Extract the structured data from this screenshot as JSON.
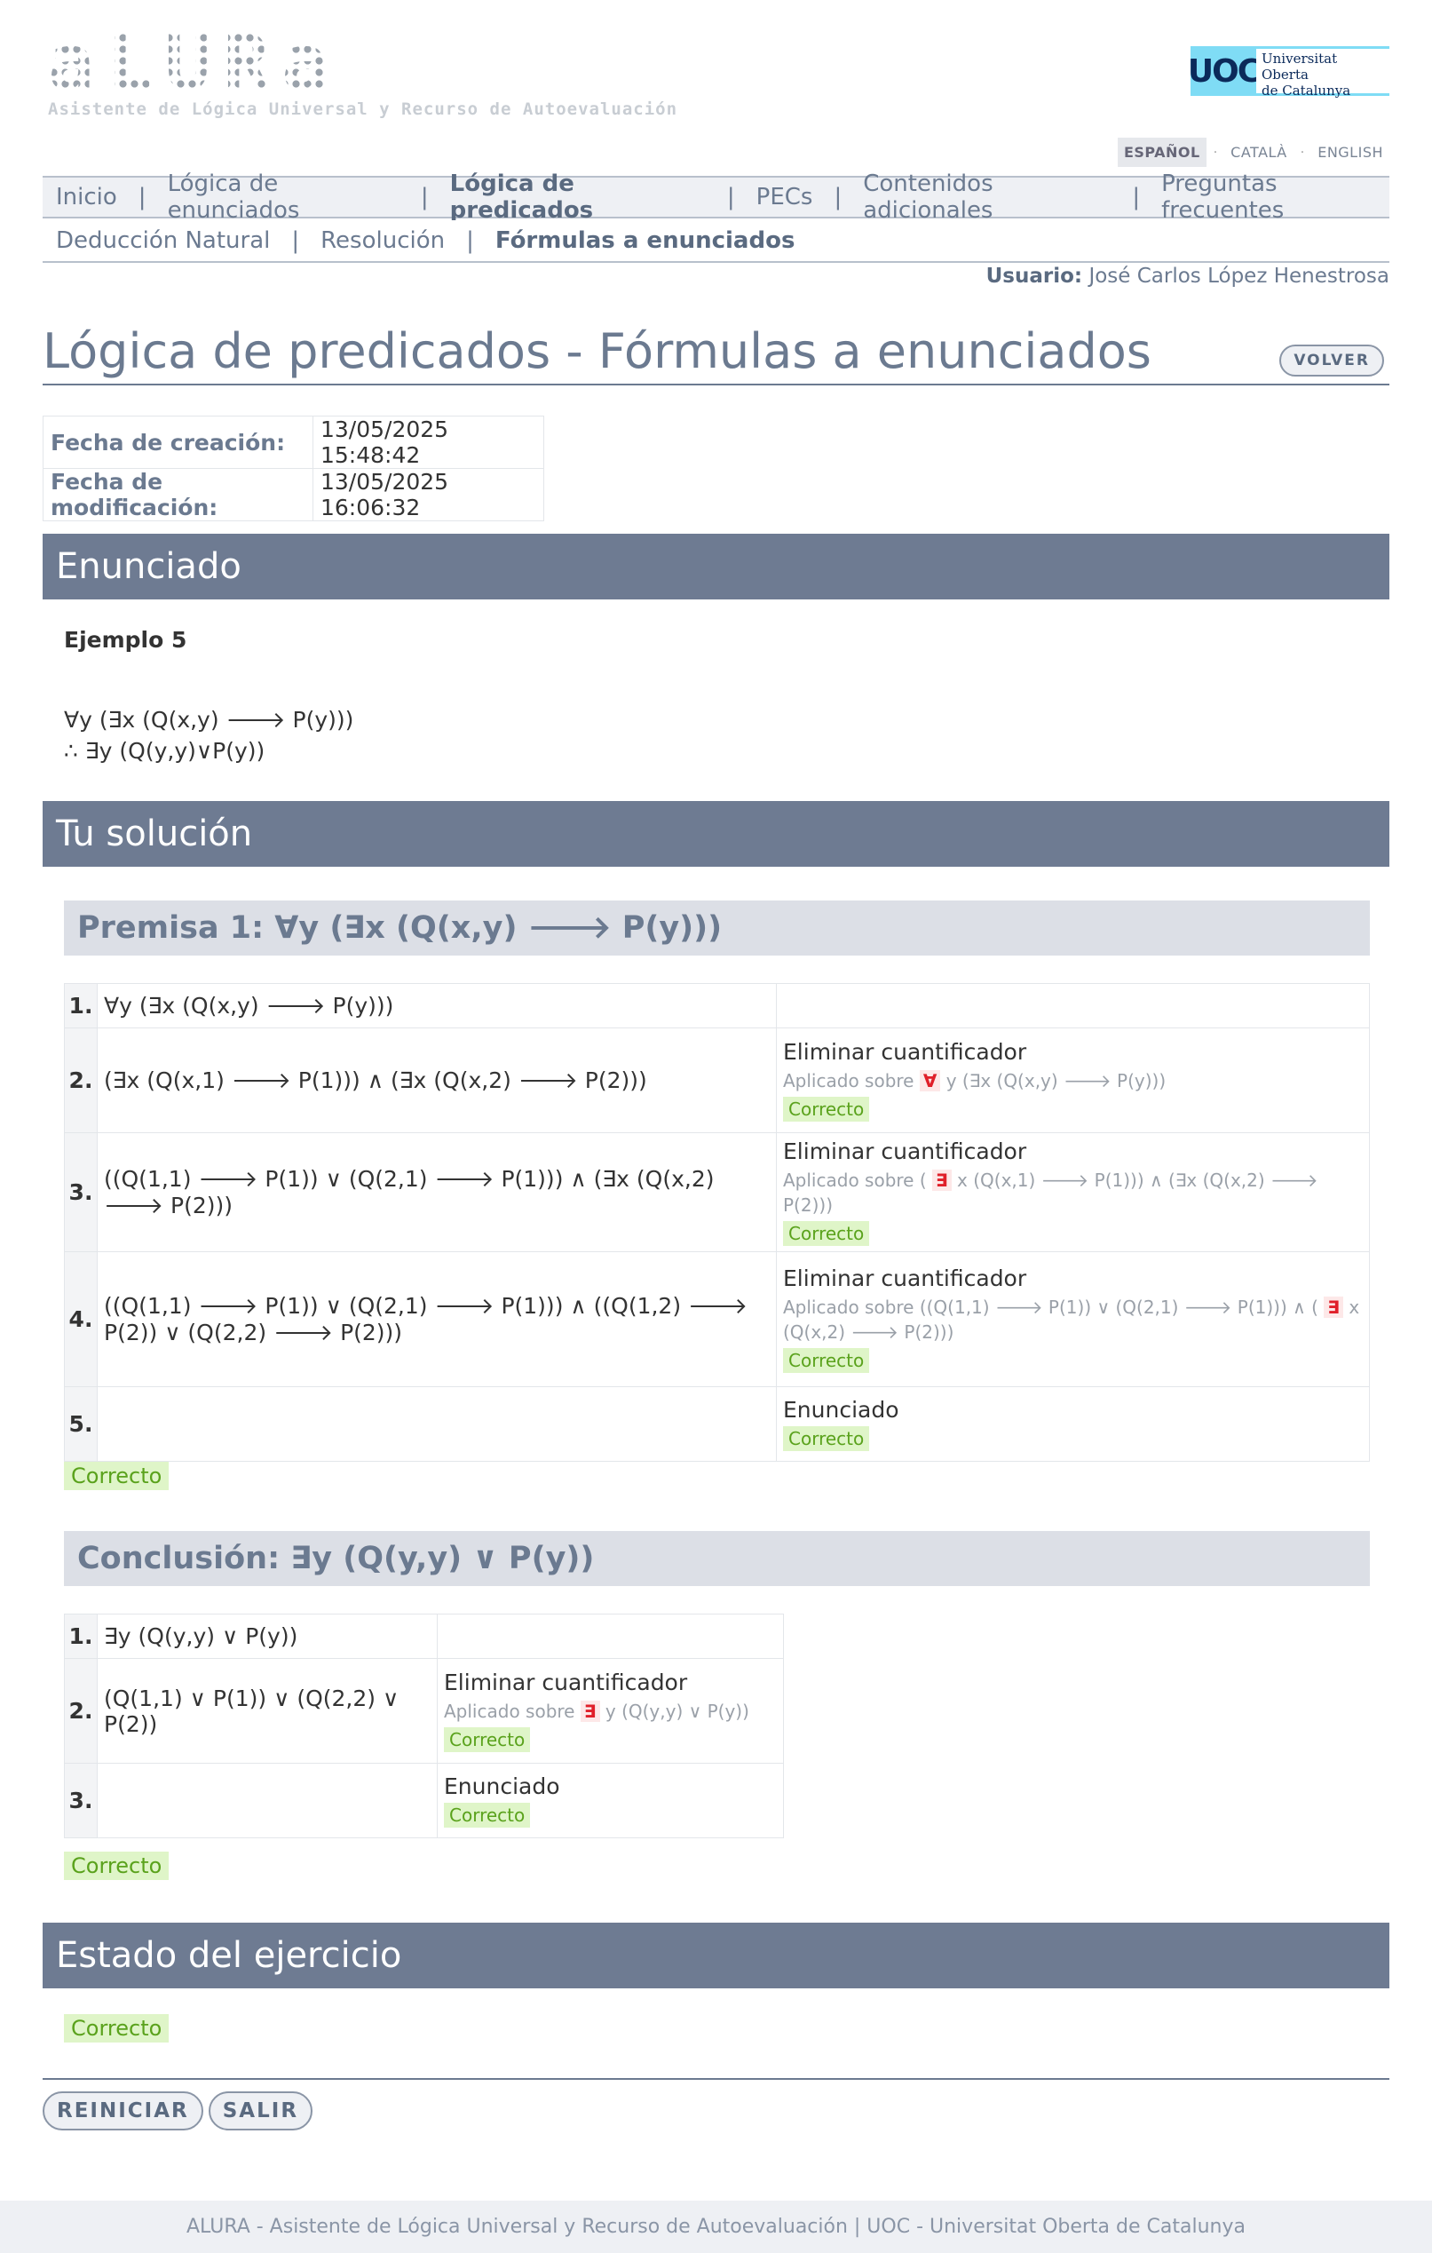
{
  "header": {
    "logo_word": "aLURa",
    "logo_subtitle": "Asistente de Lógica Universal y Recurso de Autoevaluación",
    "uoc_mark": "UOC",
    "uoc_line1": "Universitat Oberta",
    "uoc_line2": "de Catalunya"
  },
  "languages": [
    "ESPAÑOL",
    "CATALÀ",
    "ENGLISH"
  ],
  "nav_main": [
    "Inicio",
    "Lógica de enunciados",
    "Lógica de predicados",
    "PECs",
    "Contenidos adicionales",
    "Preguntas frecuentes"
  ],
  "nav_sub": [
    "Deducción Natural",
    "Resolución",
    "Fórmulas a enunciados"
  ],
  "user": {
    "label": "Usuario:",
    "name": "José Carlos López Henestrosa"
  },
  "page_title": "Lógica de predicados - Fórmulas a enunciados",
  "volver_label": "VOLVER",
  "meta": {
    "created_label": "Fecha de creación:",
    "created_value": "13/05/2025 15:48:42",
    "modified_label": "Fecha de modificación:",
    "modified_value": "13/05/2025 16:06:32"
  },
  "sections": {
    "enunciado": "Enunciado",
    "solucion": "Tu solución",
    "estado": "Estado del ejercicio"
  },
  "enunciado": {
    "title": "Ejemplo 5",
    "premise": "∀y (∃x (Q(x,y) 🡒 P(y)))",
    "conclusion": "∴ ∃y (Q(y,y)∨P(y))"
  },
  "premisa1": {
    "heading": "Premisa 1: ∀y (∃x (Q(x,y) 🡒 P(y)))",
    "rows": [
      {
        "n": "1.",
        "formula": "∀y (∃x (Q(x,y) 🡒 P(y)))"
      },
      {
        "n": "2.",
        "formula": "(∃x (Q(x,1) 🡒 P(1))) ∧ (∃x (Q(x,2) 🡒 P(2)))",
        "rule": "Eliminar cuantificador",
        "applied_prefix": "Aplicado sobre",
        "applied_q": "∀",
        "applied_rest": "y (∃x (Q(x,y) 🡒 P(y)))",
        "status": "Correcto"
      },
      {
        "n": "3.",
        "formula": "((Q(1,1) 🡒 P(1)) ∨ (Q(2,1) 🡒 P(1))) ∧ (∃x (Q(x,2) 🡒 P(2)))",
        "rule": "Eliminar cuantificador",
        "applied_prefix": "Aplicado sobre (",
        "applied_q": "∃",
        "applied_rest": "x (Q(x,1) 🡒 P(1))) ∧ (∃x (Q(x,2) 🡒 P(2)))",
        "status": "Correcto"
      },
      {
        "n": "4.",
        "formula": "((Q(1,1) 🡒 P(1)) ∨ (Q(2,1) 🡒 P(1))) ∧ ((Q(1,2) 🡒 P(2)) ∨ (Q(2,2) 🡒 P(2)))",
        "rule": "Eliminar cuantificador",
        "applied_prefix": "Aplicado sobre ((Q(1,1) 🡒 P(1)) ∨ (Q(2,1) 🡒 P(1))) ∧ (",
        "applied_q": "∃",
        "applied_rest": "x (Q(x,2) 🡒 P(2)))",
        "status": "Correcto"
      },
      {
        "n": "5.",
        "formula": "",
        "rule": "Enunciado",
        "status": "Correcto"
      }
    ],
    "result": "Correcto"
  },
  "conclusion": {
    "heading": "Conclusión: ∃y (Q(y,y) ∨ P(y))",
    "rows": [
      {
        "n": "1.",
        "formula": "∃y (Q(y,y) ∨ P(y))"
      },
      {
        "n": "2.",
        "formula": "(Q(1,1) ∨ P(1)) ∨ (Q(2,2) ∨ P(2))",
        "rule": "Eliminar cuantificador",
        "applied_prefix": "Aplicado sobre",
        "applied_q": "∃",
        "applied_rest": "y (Q(y,y) ∨ P(y))",
        "status": "Correcto"
      },
      {
        "n": "3.",
        "formula": "",
        "rule": "Enunciado",
        "status": "Correcto"
      }
    ],
    "result": "Correcto"
  },
  "estado": "Correcto",
  "buttons": {
    "reiniciar": "REINICIAR",
    "salir": "SALIR"
  },
  "footer": "ALURA - Asistente de Lógica Universal y Recurso de Autoevaluación | UOC - Universitat Oberta de Catalunya"
}
